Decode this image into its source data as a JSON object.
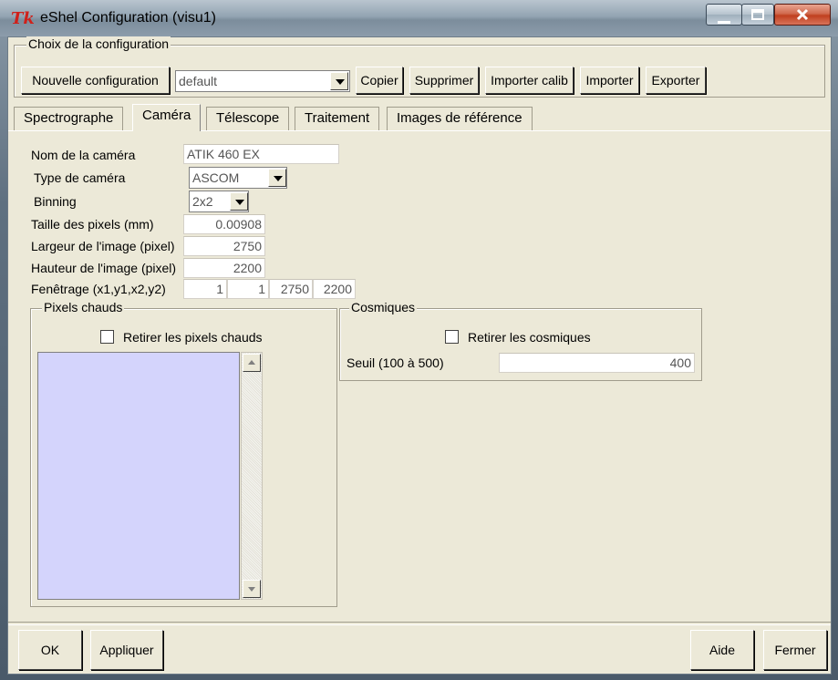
{
  "window": {
    "title": "eShel Configuration (visu1)",
    "icon": "tk-feather-icon",
    "controls": {
      "minimize": "minimize-icon",
      "maximize": "maximize-icon",
      "close": "close-icon"
    }
  },
  "config_group": {
    "label": "Choix de la configuration",
    "new_button": "Nouvelle configuration",
    "selected": "default",
    "buttons": [
      "Copier",
      "Supprimer",
      "Importer calib",
      "Importer",
      "Exporter"
    ]
  },
  "tabs": [
    {
      "label": "Spectrographe",
      "active": false
    },
    {
      "label": "Caméra",
      "active": true
    },
    {
      "label": "Télescope",
      "active": false
    },
    {
      "label": "Traitement",
      "active": false
    },
    {
      "label": "Images de référence",
      "active": false
    }
  ],
  "camera": {
    "name_label": "Nom de la caméra",
    "name_value": "ATIK 460 EX",
    "type_label": "Type de caméra",
    "type_value": "ASCOM",
    "binning_label": "Binning",
    "binning_value": "2x2",
    "pixel_size_label": "Taille des pixels (mm)",
    "pixel_size_value": "0.00908",
    "width_label": "Largeur de l'image (pixel)",
    "width_value": "2750",
    "height_label": "Hauteur de l'image (pixel)",
    "height_value": "2200",
    "window_label": "Fenêtrage (x1,y1,x2,y2)",
    "window_values": [
      "1",
      "1",
      "2750",
      "2200"
    ]
  },
  "hot_pixels": {
    "label": "Pixels chauds",
    "checkbox_label": "Retirer les pixels chauds",
    "list_color": "#d4d4fc"
  },
  "cosmics": {
    "label": "Cosmiques",
    "checkbox_label": "Retirer les cosmiques",
    "threshold_label": "Seuil (100 à 500)",
    "threshold_value": "400"
  },
  "footer": {
    "ok": "OK",
    "apply": "Appliquer",
    "help": "Aide",
    "close": "Fermer"
  }
}
